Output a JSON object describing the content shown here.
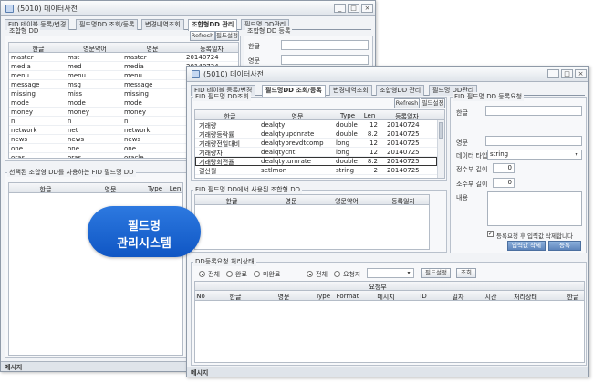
{
  "back_window": {
    "title": "(5010) 데이터사전",
    "tabs": [
      "FID 테이블 등록/변경",
      "필드명DD 조회/등록",
      "변경내역조회",
      "조합형DD 관리",
      "필드명 DD관리"
    ],
    "active_tab": 3,
    "list_panel": {
      "legend": "조합형 DD",
      "refresh_label": "Refresh",
      "settings_label": "필드설정",
      "columns": [
        "한글",
        "영문약어",
        "영문",
        "등록일자"
      ],
      "rows": [
        [
          "master",
          "mst",
          "master",
          "20140724"
        ],
        [
          "media",
          "med",
          "media",
          "20140724"
        ],
        [
          "menu",
          "menu",
          "menu",
          "20140724"
        ],
        [
          "message",
          "msg",
          "message",
          "20140724"
        ],
        [
          "missing",
          "miss",
          "missing",
          "20140724"
        ],
        [
          "mode",
          "mode",
          "mode",
          "20140724"
        ],
        [
          "money",
          "money",
          "money",
          "20140724"
        ],
        [
          "n",
          "n",
          "n",
          "20140724"
        ],
        [
          "network",
          "net",
          "network",
          "20140724"
        ],
        [
          "news",
          "news",
          "news",
          "20140724"
        ],
        [
          "one",
          "one",
          "one",
          "20140724"
        ],
        [
          "oras",
          "oras",
          "oracle",
          "20140724"
        ]
      ]
    },
    "usage_panel": {
      "legend": "선택된 조합형 DD를 사용하는 FID 필드명 DD",
      "columns": [
        "한글",
        "영문",
        "Type",
        "Len"
      ]
    },
    "register_panel": {
      "legend": "조합형 DD 등록",
      "fields": [
        "한글",
        "영문"
      ]
    },
    "status": "메시지"
  },
  "front_window": {
    "title": "(5010) 데이터사전",
    "tabs": [
      "FID 테이블 등록/변경",
      "필드명DD 조회/등록",
      "변경내역조회",
      "조합형DD 관리",
      "필드명 DD관리"
    ],
    "active_tab": 1,
    "list_panel": {
      "legend": "FID 필드명 DD조회",
      "refresh_label": "Refresh",
      "settings_label": "필드설정",
      "columns": [
        "한글",
        "영문",
        "Type",
        "Len",
        "등록일자"
      ],
      "rows": [
        [
          "거래량",
          "dealqty",
          "double",
          "12",
          "20140724"
        ],
        [
          "거래량등락률",
          "dealqtyupdnrate",
          "double",
          "8.2",
          "20140725"
        ],
        [
          "거래량전일대비",
          "dealqtyprevdtcomp",
          "long",
          "12",
          "20140725"
        ],
        [
          "거래량차",
          "dealqtycnt",
          "long",
          "12",
          "20140725"
        ],
        [
          "거래량회전율",
          "dealqtyturnrate",
          "double",
          "8.2",
          "20140725"
        ],
        [
          "결산월",
          "setlmon",
          "string",
          "2",
          "20140725"
        ]
      ],
      "selected_row": 4
    },
    "used_panel": {
      "legend": "FID 필드명 DD에서 사용된 조합형 DD",
      "columns": [
        "한글",
        "영문",
        "영문약어",
        "등록일자"
      ]
    },
    "request_panel": {
      "legend": "FID 필드명 DD 등록요청",
      "korean_label": "한글",
      "english_label": "영문",
      "datatype_label": "데이터 타입",
      "datatype_value": "string",
      "int_len_label": "정수부 길이",
      "int_len_value": "0",
      "dec_len_label": "소수부 길이",
      "dec_len_value": "0",
      "content_label": "내용",
      "auto_delete_label": "등록요청 후 입력값 삭제합니다",
      "auto_delete_checked": true,
      "clear_button": "입력값 삭제",
      "register_button": "등록"
    },
    "process_panel": {
      "legend": "DD등록요청 처리상태",
      "status_radios": [
        "전체",
        "완료",
        "미완료"
      ],
      "status_selected": 0,
      "scope_radios": [
        "전체",
        "요청자"
      ],
      "scope_selected": 0,
      "settings_button": "필드설정",
      "search_button": "조회",
      "group_header": "요청부",
      "columns": [
        "No",
        "한글",
        "영문",
        "Type",
        "Format",
        "메시지",
        "ID",
        "일자",
        "시간",
        "처리상태",
        "한글"
      ]
    },
    "status": "메시지"
  },
  "overlay": {
    "line1": "필드명",
    "line2": "관리시스템",
    "color": "#1a63d2"
  }
}
